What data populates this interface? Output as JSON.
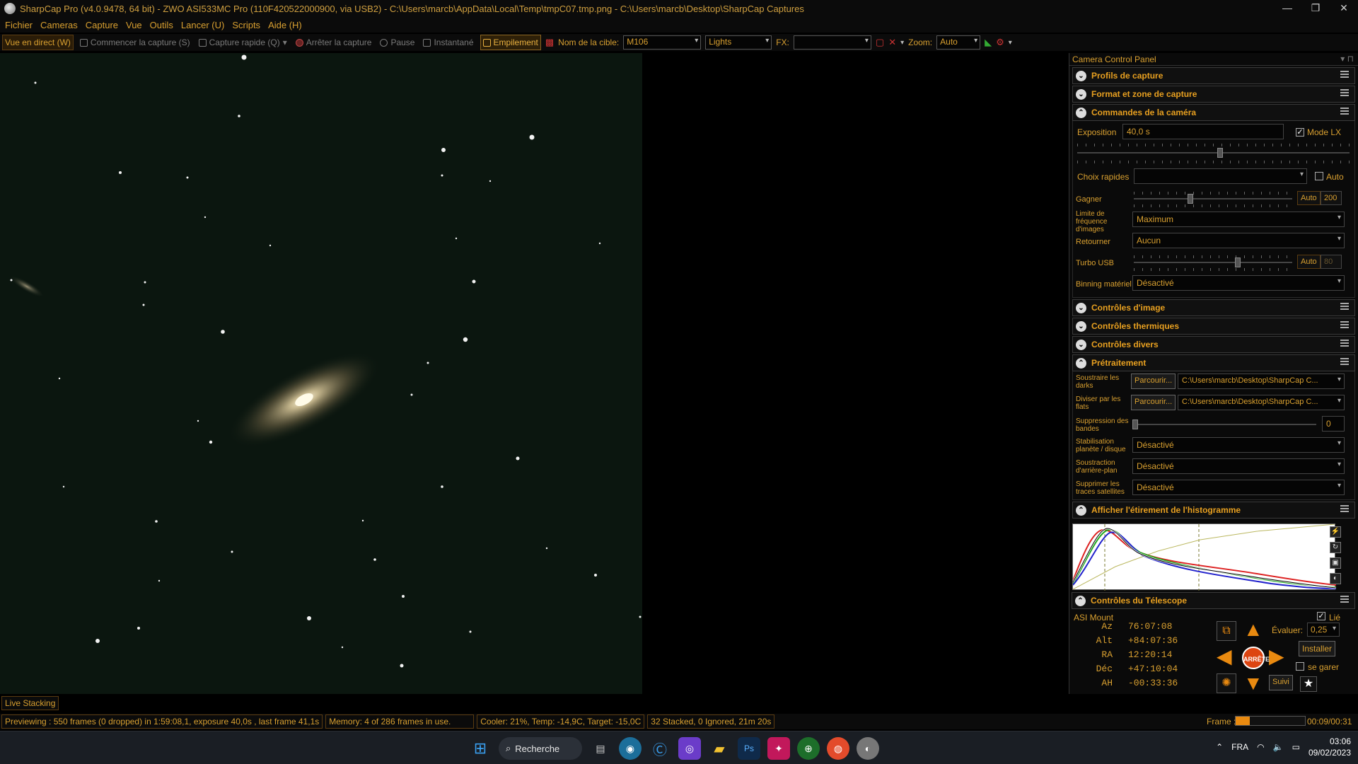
{
  "window": {
    "title": "SharpCap Pro (v4.0.9478, 64 bit) - ZWO ASI533MC Pro (110F420522000900, via USB2) - C:\\Users\\marcb\\AppData\\Local\\Temp\\tmpC07.tmp.png - C:\\Users\\marcb\\Desktop\\SharpCap Captures",
    "minimize": "—",
    "maximize": "❐",
    "close": "✕"
  },
  "menu": [
    "Fichier",
    "Cameras",
    "Capture",
    "Vue",
    "Outils",
    "Lancer (U)",
    "Scripts",
    "Aide (H)"
  ],
  "toolbar": {
    "live_view": "Vue en direct (W)",
    "start_capture": "Commencer la capture (S)",
    "quick_capture": "Capture rapide (Q)",
    "stop_capture": "Arrêter la capture",
    "pause": "Pause",
    "snapshot": "Instantané",
    "stacking": "Empilement",
    "target_label": "Nom de la cible:",
    "target_value": "M106",
    "frame_type": "Lights",
    "fx_label": "FX:",
    "fx_value": "",
    "zoom_label": "Zoom:",
    "zoom_value": "Auto"
  },
  "live_stacking_tab": "Live Stacking",
  "status": {
    "preview": "Previewing : 550 frames (0 dropped) in 1:59:08,1, exposure 40,0s , last frame 41,1s",
    "memory": "Memory: 4 of 286 frames in use.",
    "cooler": "Cooler: 21%, Temp: -14,9C, Target: -15,0C",
    "stacked": "32 Stacked, 0 Ignored, 21m 20s",
    "frame_label": "Frame :",
    "frame_progress": 0.2,
    "frame_time": "00:09/00:31"
  },
  "panel": {
    "title": "Camera Control Panel",
    "sections": {
      "capture_profiles": "Profils de capture",
      "format_area": "Format et zone de capture",
      "camera_controls": "Commandes de la caméra",
      "image_controls": "Contrôles d'image",
      "thermal_controls": "Contrôles thermiques",
      "misc_controls": "Contrôles divers",
      "preprocessing": "Prétraitement",
      "histogram": "Afficher l'étirement de l'histogramme",
      "telescope": "Contrôles du Télescope"
    },
    "camera": {
      "exposure_label": "Exposition",
      "exposure_value": "40,0 s",
      "lx_mode": "Mode LX",
      "quick_picks_label": "Choix rapides",
      "quick_picks_value": "",
      "auto_label": "Auto",
      "gain_label": "Gagner",
      "gain_auto": "Auto",
      "gain_value": "200",
      "gain_level": 0.35,
      "framerate_label": "Limite de fréquence d'images",
      "framerate_value": "Maximum",
      "flip_label": "Retourner",
      "flip_value": "Aucun",
      "usb_label": "Turbo USB",
      "usb_auto": "Auto",
      "usb_value": "80",
      "usb_level": 0.66,
      "binning_label": "Binning matériel",
      "binning_value": "Désactivé"
    },
    "preprocess": {
      "darks_label": "Soustraire les darks",
      "darks_btn": "Parcourir...",
      "darks_path": "C:\\Users\\marcb\\Desktop\\SharpCap C...",
      "flats_label": "Diviser par les flats",
      "flats_btn": "Parcourir...",
      "flats_path": "C:\\Users\\marcb\\Desktop\\SharpCap C...",
      "banding_label": "Suppression des bandes",
      "banding_value": "0",
      "stab_label": "Stabilisation planète / disque",
      "stab_value": "Désactivé",
      "bg_label": "Soustraction d'arrière-plan",
      "bg_value": "Désactivé",
      "sat_label": "Supprimer les traces satellites",
      "sat_value": "Désactivé"
    },
    "telescope": {
      "mount": "ASI Mount",
      "linked": "Lié",
      "rate_label": "Évaluer:",
      "rate_value": "0,25",
      "install_btn": "Installer",
      "park_label": "se garer",
      "stop_btn": "ARRÊTE",
      "track_btn": "Suivi",
      "coords": [
        {
          "k": "Az",
          "v": "76:07:08"
        },
        {
          "k": "Alt",
          "v": "+84:07:36"
        },
        {
          "k": "RA",
          "v": "12:20:14"
        },
        {
          "k": "Déc",
          "v": "+47:10:04"
        },
        {
          "k": "AH",
          "v": "-00:33:36"
        }
      ]
    }
  },
  "taskbar": {
    "search": "Recherche",
    "lang": "FRA",
    "time": "03:06",
    "date": "09/02/2023"
  },
  "colors": {
    "accent": "#d9a030",
    "sky": "#0b160f",
    "taskbar": "#1a1e24"
  }
}
